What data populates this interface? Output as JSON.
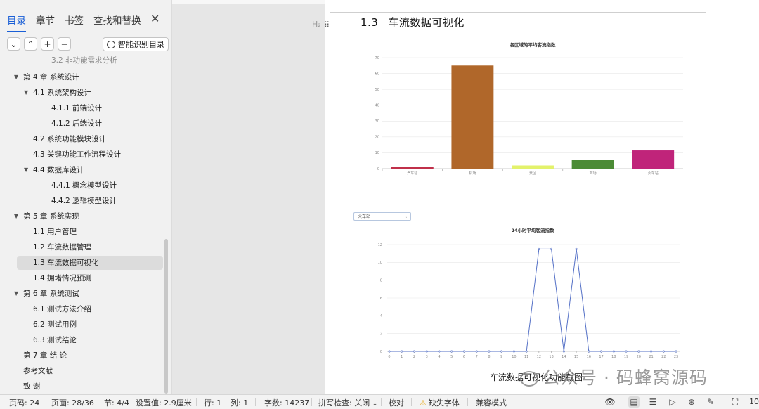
{
  "nav": {
    "tabs": [
      "目录",
      "章节",
      "书签",
      "查找和替换"
    ],
    "active_tab": "目录",
    "smart_toc_label": "智能识别目录",
    "toc": [
      {
        "text": "3.2 非功能需求分析",
        "level": 3,
        "partial": true
      },
      {
        "text": "第 4 章 系统设计",
        "level": 1,
        "caret": "▼"
      },
      {
        "text": "4.1 系统架构设计",
        "level": 2,
        "caret": "▼"
      },
      {
        "text": "4.1.1 前端设计",
        "level": 3
      },
      {
        "text": "4.1.2 后端设计",
        "level": 3
      },
      {
        "text": "4.2 系统功能模块设计",
        "level": 2
      },
      {
        "text": "4.3 关键功能工作流程设计",
        "level": 2
      },
      {
        "text": "4.4 数据库设计",
        "level": 2,
        "caret": "▼"
      },
      {
        "text": "4.4.1 概念模型设计",
        "level": 3
      },
      {
        "text": "4.4.2 逻辑模型设计",
        "level": 3
      },
      {
        "text": "第 5 章 系统实现",
        "level": 1,
        "caret": "▼"
      },
      {
        "text": "1.1 用户管理",
        "level": 2
      },
      {
        "text": "1.2 车流数据管理",
        "level": 2
      },
      {
        "text": "1.3 车流数据可视化",
        "level": 2,
        "selected": true
      },
      {
        "text": "1.4 拥堵情况预测",
        "level": 2
      },
      {
        "text": "第 6 章 系统测试",
        "level": 1,
        "caret": "▼"
      },
      {
        "text": "6.1 测试方法介绍",
        "level": 2
      },
      {
        "text": "6.2 测试用例",
        "level": 2
      },
      {
        "text": "6.3 测试结论",
        "level": 2
      },
      {
        "text": "第 7 章 结 论",
        "level": 1
      },
      {
        "text": "参考文献",
        "level": 1
      },
      {
        "text": "致 谢",
        "level": 1
      }
    ]
  },
  "doc": {
    "heading_marker": "H₂",
    "section_number": "1.3",
    "section_title": "车流数据可视化",
    "dropdown_value": "火车站",
    "caption": "车流数据可视化功能截图",
    "watermark": "公众号 · 码蜂窝源码"
  },
  "chart_data": [
    {
      "type": "bar",
      "title": "各区域的平均客流指数",
      "categories": [
        "汽车站",
        "机场",
        "景区",
        "商场",
        "火车站"
      ],
      "values": [
        1,
        65,
        2,
        5.5,
        11.5
      ],
      "colors": [
        "#c0304a",
        "#b0672a",
        "#e3f26b",
        "#4b8b35",
        "#c0247a"
      ],
      "ylim": [
        0,
        70
      ],
      "yticks": [
        0,
        10,
        20,
        30,
        40,
        50,
        60,
        70
      ]
    },
    {
      "type": "line",
      "title": "24小时平均客流指数",
      "x": [
        0,
        1,
        2,
        3,
        4,
        5,
        6,
        7,
        8,
        9,
        10,
        11,
        12,
        13,
        14,
        15,
        16,
        17,
        18,
        19,
        20,
        21,
        22,
        23
      ],
      "series": [
        {
          "values": [
            0,
            0,
            0,
            0,
            0,
            0,
            0,
            0,
            0,
            0,
            0,
            0,
            11.5,
            11.5,
            0,
            11.5,
            0,
            0,
            0,
            0,
            0,
            0,
            0,
            0
          ],
          "color": "#5470c6"
        }
      ],
      "ylim": [
        0,
        12
      ],
      "yticks": [
        0,
        2,
        4,
        6,
        8,
        10,
        12
      ]
    }
  ],
  "status": {
    "page_code": "页码: 24",
    "page": "页面: 28/36",
    "section": "节: 4/4",
    "setting": "设置值: 2.9厘米",
    "row": "行: 1",
    "col": "列: 1",
    "words": "字数: 14237",
    "spell": "拼写检查: 关闭",
    "proof": "校对",
    "missing_font": "缺失字体",
    "compat": "兼容模式",
    "zoom": "10"
  }
}
